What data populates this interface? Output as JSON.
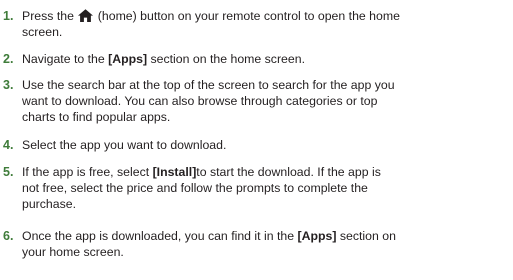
{
  "steps": [
    {
      "number": "1.",
      "line1_before": "Press the ",
      "icon": "home-icon",
      "line1_after": " (home) button on your remote control to open the home",
      "line2": "screen."
    },
    {
      "number": "2.",
      "before": "Navigate to the ",
      "bold": "[Apps]",
      "after": " section on the home screen."
    },
    {
      "number": "3.",
      "lines": [
        "Use the search bar at the top of the screen to search for the app you",
        "want to download. You can also browse through categories or top",
        "charts to find popular apps."
      ]
    },
    {
      "number": "4.",
      "lines": [
        "Select the app you want to download."
      ]
    },
    {
      "number": "5.",
      "line1_before": "If the app is free, select ",
      "line1_bold": "[Install]",
      "line1_after": "to start the download. If the app is",
      "lines": [
        "not free, select the price and follow the prompts to complete the",
        "purchase."
      ]
    },
    {
      "number": "6.",
      "line1_before": "Once the app is downloaded, you can find it in the ",
      "line1_bold": "[Apps]",
      "line1_after": " section on",
      "line2": "your home screen."
    }
  ],
  "colors": {
    "number": "#3f7c3a",
    "text": "#231f20"
  }
}
